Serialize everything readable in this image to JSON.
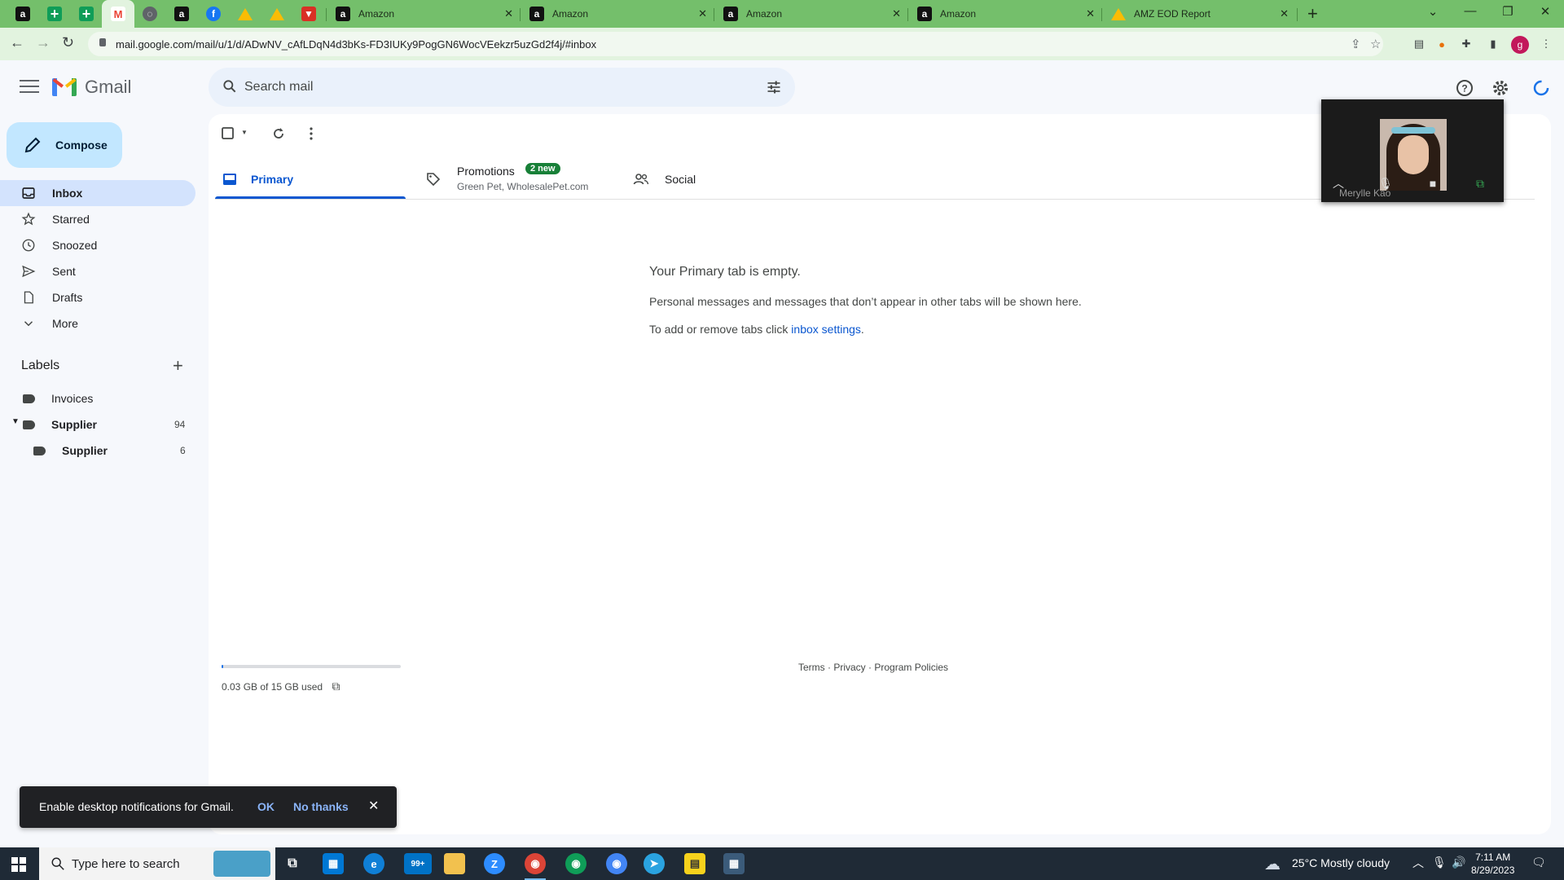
{
  "browser": {
    "tabs": [
      {
        "title": "Amazon",
        "favicon": "amazon-icon"
      },
      {
        "title": "Amazon",
        "favicon": "amazon-icon"
      },
      {
        "title": "Amazon",
        "favicon": "amazon-icon"
      },
      {
        "title": "Amazon",
        "favicon": "amazon-icon"
      },
      {
        "title": "AMZ EOD Report",
        "favicon": "drive-icon"
      }
    ],
    "pinned_favicons": [
      "amazon-icon",
      "sheets-icon",
      "sheets-icon",
      "gmail-icon",
      "globe-icon",
      "amazon-icon",
      "facebook-icon",
      "drive-icon",
      "drive-icon",
      "red-app-icon"
    ],
    "url": "mail.google.com/mail/u/1/d/ADwNV_cAfLDqN4d3bKs-FD3IUKy9PogGN6WocVEekzr5uzGd2f4j/#inbox",
    "profile_initial": "g",
    "colors": {
      "tabstrip": "#74bf6b",
      "toolbar": "#e2f3df"
    }
  },
  "gmail": {
    "logo_text": "Gmail",
    "search_placeholder": "Search mail",
    "compose_label": "Compose",
    "nav": [
      {
        "label": "Inbox",
        "icon": "inbox-icon",
        "active": true
      },
      {
        "label": "Starred",
        "icon": "star-icon"
      },
      {
        "label": "Snoozed",
        "icon": "clock-icon"
      },
      {
        "label": "Sent",
        "icon": "send-icon"
      },
      {
        "label": "Drafts",
        "icon": "draft-icon"
      },
      {
        "label": "More",
        "icon": "chevron-down-icon"
      }
    ],
    "labels_title": "Labels",
    "labels": [
      {
        "name": "Invoices",
        "count": ""
      },
      {
        "name": "Supplier",
        "count": "94"
      },
      {
        "name": "Supplier",
        "count": "6"
      }
    ],
    "tabs": {
      "primary": "Primary",
      "promotions": "Promotions",
      "promotions_badge": "2 new",
      "promotions_sub": "Green Pet, WholesalePet.com",
      "social": "Social"
    },
    "empty": {
      "title": "Your Primary tab is empty.",
      "line1": "Personal messages and messages that don’t appear in other tabs will be shown here.",
      "line2_prefix": "To add or remove tabs click ",
      "line2_link": "inbox settings",
      "line2_suffix": "."
    },
    "storage": {
      "text": "0.03 GB of 15 GB used",
      "fraction": 0.002
    },
    "footer": {
      "terms": "Terms",
      "privacy": "Privacy",
      "policies": "Program Policies",
      "sep": " · "
    },
    "accent": "#0b57d0"
  },
  "pip": {
    "name": "Merylle Kao"
  },
  "snackbar": {
    "message": "Enable desktop notifications for Gmail.",
    "ok": "OK",
    "no_thanks": "No thanks"
  },
  "taskbar": {
    "search_placeholder": "Type here to search",
    "mail_badge": "99+",
    "weather": "25°C  Mostly cloudy",
    "time": "7:11 AM",
    "date": "8/29/2023"
  }
}
